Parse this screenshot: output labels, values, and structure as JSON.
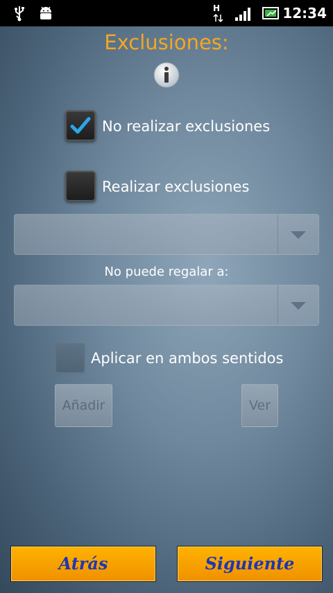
{
  "status_bar": {
    "time": "12:34",
    "network_type": "H",
    "icons": [
      "usb-icon",
      "android-debug-icon",
      "network-activity-icon",
      "signal-icon",
      "battery-icon"
    ]
  },
  "title": "Exclusiones:",
  "options": {
    "no_exclusions": {
      "label": "No realizar exclusiones",
      "checked": true
    },
    "do_exclusions": {
      "label": "Realizar exclusiones",
      "checked": false
    }
  },
  "spinner_1": {
    "value": ""
  },
  "cannot_give_label": "No puede regalar a:",
  "spinner_2": {
    "value": ""
  },
  "both_ways": {
    "label": "Aplicar en ambos sentidos",
    "checked": false,
    "enabled": false
  },
  "buttons": {
    "add": "Añadir",
    "view": "Ver",
    "back": "Atrás",
    "next": "Siguiente"
  },
  "colors": {
    "title": "#f5a623",
    "nav_button": "#f5a000",
    "nav_text": "#1d37b4"
  }
}
